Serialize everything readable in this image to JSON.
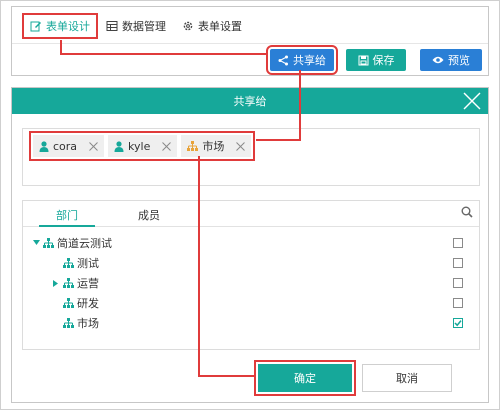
{
  "tabs": [
    {
      "label": "表单设计",
      "icon": "edit-icon",
      "active": true
    },
    {
      "label": "数据管理",
      "icon": "table-icon",
      "active": false
    },
    {
      "label": "表单设置",
      "icon": "gear-icon",
      "active": false
    }
  ],
  "toolbar": {
    "share_label": "共享给",
    "save_label": "保存",
    "preview_label": "预览"
  },
  "dialog": {
    "title": "共享给",
    "selected": [
      {
        "label": "cora",
        "icon": "user-icon"
      },
      {
        "label": "kyle",
        "icon": "user-icon"
      },
      {
        "label": "市场",
        "icon": "org-icon"
      }
    ],
    "panel_tabs": {
      "dept": "部门",
      "member": "成员"
    },
    "tree": [
      {
        "label": "简道云测试",
        "level": 0,
        "expanded": true,
        "checked": false
      },
      {
        "label": "测试",
        "level": 1,
        "expanded": false,
        "checked": false
      },
      {
        "label": "运营",
        "level": 1,
        "expanded": false,
        "has_children": true,
        "checked": false
      },
      {
        "label": "研发",
        "level": 1,
        "expanded": false,
        "checked": false
      },
      {
        "label": "市场",
        "level": 1,
        "expanded": false,
        "checked": true
      }
    ],
    "ok_label": "确定",
    "cancel_label": "取消"
  },
  "colors": {
    "accent": "#16a89a",
    "blue": "#2a7fd6",
    "highlight": "#e03b3b",
    "org": "#e8a33a"
  }
}
